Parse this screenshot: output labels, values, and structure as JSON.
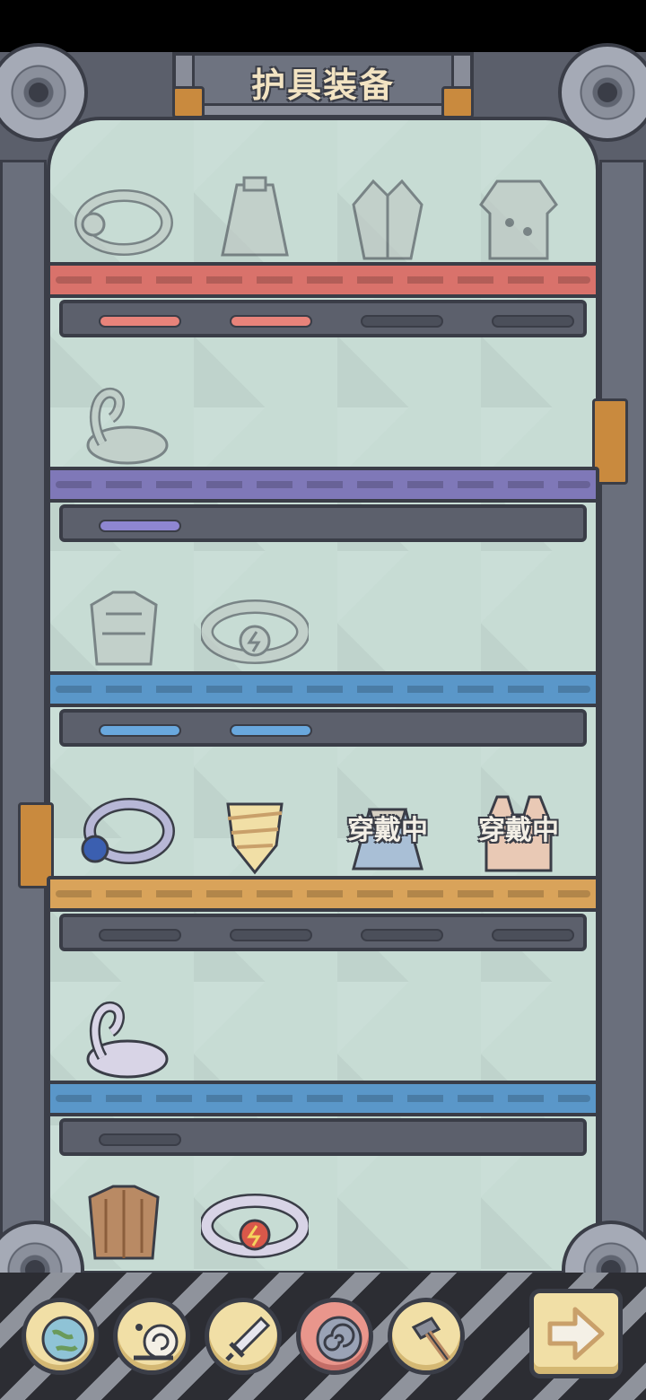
{
  "screen": {
    "title": "护具装备"
  },
  "colors": {
    "frame": "#5b5f6b",
    "outline": "#3a3d47",
    "back_panel": "#c7dcd4",
    "accent_red": "#d9726b",
    "accent_purple": "#7f78b8",
    "accent_blue": "#5a97c9",
    "accent_orange": "#d9a35a",
    "nav_button": "#f1dfa6",
    "nav_button_active": "#e9968c"
  },
  "shelves": [
    {
      "color": "#d9726b",
      "bar_color": "#e8837a",
      "bars_filled": 2,
      "bars_total": 4,
      "items": [
        {
          "icon": "ring-icon",
          "status": "",
          "locked": true
        },
        {
          "icon": "cape-icon",
          "status": "",
          "locked": true
        },
        {
          "icon": "robe-icon",
          "status": "",
          "locked": true
        },
        {
          "icon": "armor-vest-icon",
          "status": "",
          "locked": true
        }
      ]
    },
    {
      "color": "#7f78b8",
      "bar_color": "#8e86d1",
      "bars_filled": 1,
      "bars_total": 1,
      "items": [
        {
          "icon": "swan-float-icon",
          "status": "",
          "locked": true
        }
      ]
    },
    {
      "color": "#5a97c9",
      "bar_color": "#69a8de",
      "bars_filled": 2,
      "bars_total": 2,
      "items": [
        {
          "icon": "stone-armor-icon",
          "status": "",
          "locked": true
        },
        {
          "icon": "lightning-ring-icon",
          "status": "",
          "locked": true
        }
      ]
    },
    {
      "color": "#d9a35a",
      "bar_color": "#6e7380",
      "bars_filled": 0,
      "bars_total": 4,
      "items": [
        {
          "icon": "sapphire-ring-icon",
          "status": "",
          "locked": false
        },
        {
          "icon": "bandage-wrap-icon",
          "status": "",
          "locked": false
        },
        {
          "icon": "skirt-icon",
          "status": "穿戴中",
          "locked": false
        },
        {
          "icon": "tank-top-icon",
          "status": "穿戴中",
          "locked": false
        }
      ]
    },
    {
      "color": "#5a97c9",
      "bar_color": "#6e7380",
      "bars_filled": 0,
      "bars_total": 1,
      "items": [
        {
          "icon": "swan-float-icon",
          "status": "",
          "locked": false
        }
      ]
    },
    {
      "color": "#5a97c9",
      "bar_color": "#6e7380",
      "bars_filled": 0,
      "bars_total": 0,
      "items": [
        {
          "icon": "wood-armor-icon",
          "status": "",
          "locked": false
        },
        {
          "icon": "lightning-ring-icon",
          "status": "",
          "locked": false
        }
      ]
    }
  ],
  "bottom_nav": [
    {
      "icon": "globe-icon",
      "active": false
    },
    {
      "icon": "snail-icon",
      "active": false
    },
    {
      "icon": "sword-icon",
      "active": false
    },
    {
      "icon": "shield-spiral-icon",
      "active": true
    },
    {
      "icon": "hammer-icon",
      "active": false
    }
  ],
  "next_button": {
    "icon": "arrow-right-icon"
  }
}
